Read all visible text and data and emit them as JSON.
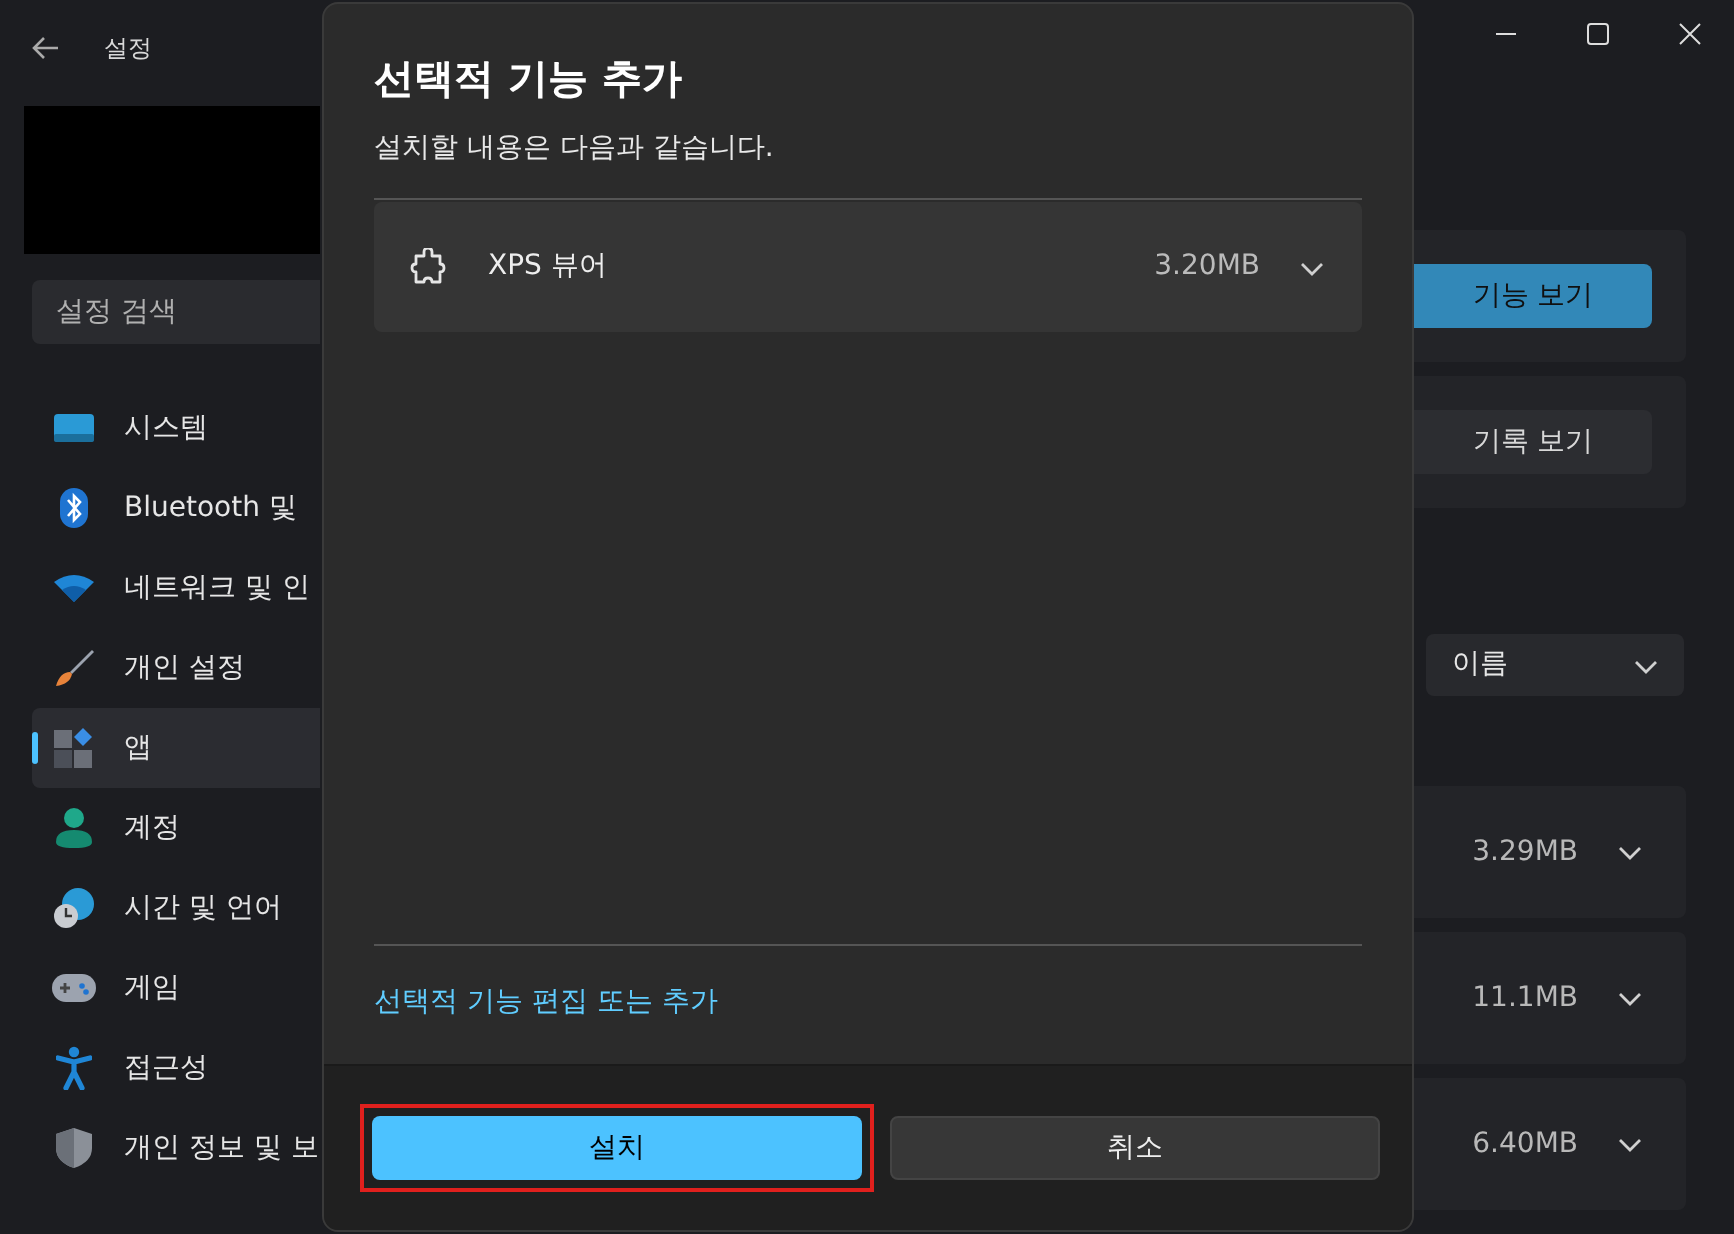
{
  "window": {
    "title": "설정"
  },
  "sidebar": {
    "search": {
      "placeholder": "설정 검색"
    },
    "items": [
      {
        "label": "시스템",
        "selected": false
      },
      {
        "label": "Bluetooth 및",
        "selected": false
      },
      {
        "label": "네트워크 및 인",
        "selected": false
      },
      {
        "label": "개인 설정",
        "selected": false
      },
      {
        "label": "앱",
        "selected": true
      },
      {
        "label": "계정",
        "selected": false
      },
      {
        "label": "시간 및 언어",
        "selected": false
      },
      {
        "label": "게임",
        "selected": false
      },
      {
        "label": "접근성",
        "selected": false
      },
      {
        "label": "개인 정보 및 보",
        "selected": false
      }
    ]
  },
  "main": {
    "cards": [
      {
        "button": "기능 보기",
        "kind": "primary"
      },
      {
        "button": "기록 보기",
        "kind": "secondary"
      }
    ],
    "sort": {
      "value": "이름"
    },
    "features": [
      {
        "size": "3.29MB",
        "expanded": false
      },
      {
        "size": "11.1MB",
        "expanded": false
      },
      {
        "size": "6.40MB",
        "expanded": false
      }
    ]
  },
  "dialog": {
    "title": "선택적 기능 추가",
    "subtitle": "설치할 내용은 다음과 같습니다.",
    "items": [
      {
        "name": "XPS 뷰어",
        "size": "3.20MB",
        "expanded": false
      }
    ],
    "link": "선택적 기능 편집 또는 추가",
    "buttons": [
      {
        "label": "설치",
        "kind": "primary",
        "highlighted": true
      },
      {
        "label": "취소",
        "kind": "secondary",
        "highlighted": false
      }
    ]
  }
}
